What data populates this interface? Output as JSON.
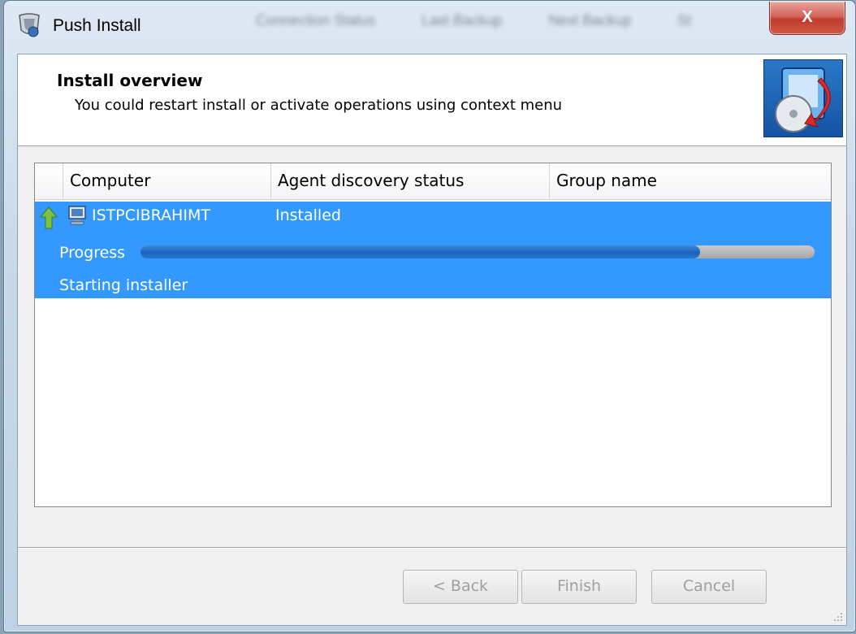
{
  "window": {
    "title": "Push Install",
    "close_glyph": "X",
    "background_tabs": [
      "Connection Status",
      "Last Backup",
      "Next Backup",
      "St"
    ]
  },
  "header": {
    "title": "Install overview",
    "subtitle": "You could restart install or activate operations using context menu"
  },
  "list": {
    "columns": [
      "Computer",
      "Agent discovery status",
      "Group name"
    ],
    "rows": [
      {
        "computer": "ISTPCIBRAHIMT",
        "status": "Installed",
        "group": "",
        "progress_label": "Progress",
        "progress_fraction": 0.83,
        "message": "Starting installer"
      }
    ]
  },
  "footer": {
    "back_label": "< Back",
    "finish_label": "Finish",
    "cancel_label": "Cancel"
  },
  "colors": {
    "selection": "#3399ff",
    "progress_fill": "#1a62bc",
    "close_button": "#c13a2c"
  },
  "icons": {
    "title": "push-install-shield-icon",
    "header": "install-disc-icon",
    "row_arrow": "up-arrow-icon",
    "row_computer": "computer-icon"
  }
}
